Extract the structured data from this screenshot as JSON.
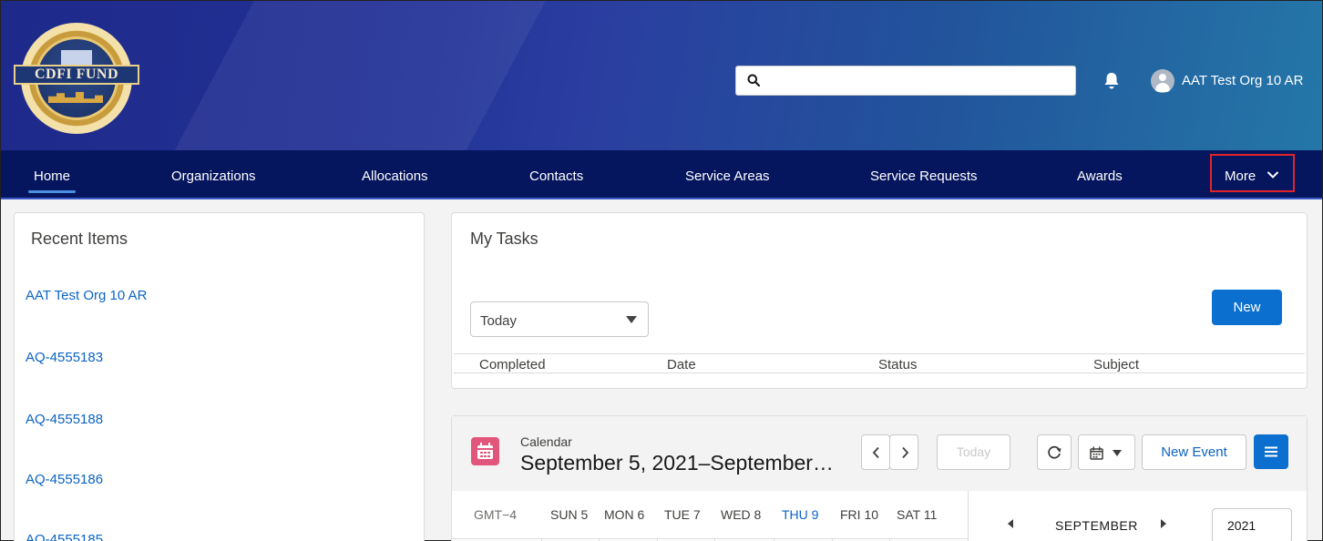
{
  "header": {
    "logo_text": "CDFI FUND",
    "search_placeholder": "",
    "user_name": "AAT Test Org 10 AR"
  },
  "nav": {
    "items": [
      "Home",
      "Organizations",
      "Allocations",
      "Contacts",
      "Service Areas",
      "Service Requests",
      "Awards"
    ],
    "active": "Home",
    "more_label": "More"
  },
  "recent": {
    "title": "Recent Items",
    "items": [
      "AAT Test Org 10 AR",
      "AQ-4555183",
      "AQ-4555188",
      "AQ-4555186",
      "AQ-4555185"
    ]
  },
  "tasks": {
    "title": "My Tasks",
    "filter_value": "Today",
    "new_label": "New",
    "columns": [
      "Completed",
      "Date",
      "Status",
      "Subject"
    ]
  },
  "calendar": {
    "label": "Calendar",
    "range": "September 5, 2021–September…",
    "today_label": "Today",
    "new_event_label": "New Event",
    "timezone": "GMT−4",
    "days": [
      "SUN 5",
      "MON 6",
      "TUE 7",
      "WED 8",
      "THU 9",
      "FRI 10",
      "SAT 11"
    ],
    "today_day": "THU 9",
    "mini_month": "SEPTEMBER",
    "mini_year": "2021"
  },
  "colors": {
    "nav_bg": "#06165e",
    "link": "#0b63c4",
    "brand_button": "#0b6fd0",
    "highlight_box": "#e0242a",
    "calendar_icon": "#e3567c"
  }
}
